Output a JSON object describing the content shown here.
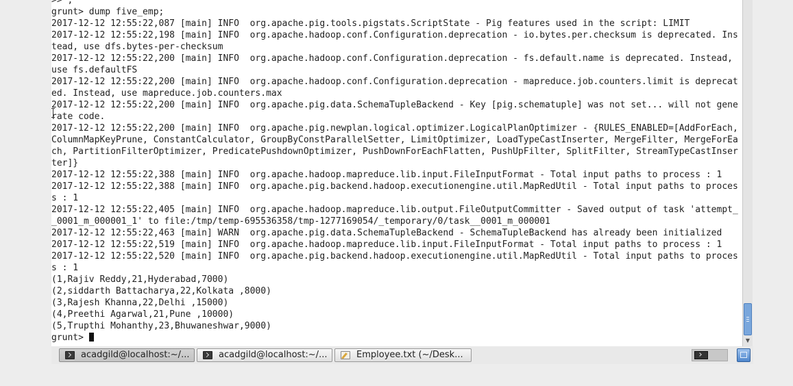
{
  "terminal": {
    "lines": [
      ">> ;",
      "grunt> dump five_emp;",
      "2017-12-12 12:55:22,087 [main] INFO  org.apache.pig.tools.pigstats.ScriptState - Pig features used in the script: LIMIT",
      "2017-12-12 12:55:22,198 [main] INFO  org.apache.hadoop.conf.Configuration.deprecation - io.bytes.per.checksum is deprecated. Instead, use dfs.bytes-per-checksum",
      "2017-12-12 12:55:22,200 [main] INFO  org.apache.hadoop.conf.Configuration.deprecation - fs.default.name is deprecated. Instead, use fs.defaultFS",
      "2017-12-12 12:55:22,200 [main] INFO  org.apache.hadoop.conf.Configuration.deprecation - mapreduce.job.counters.limit is deprecated. Instead, use mapreduce.job.counters.max",
      "2017-12-12 12:55:22,200 [main] INFO  org.apache.pig.data.SchemaTupleBackend - Key [pig.schematuple] was not set... will not generate code.",
      "2017-12-12 12:55:22,200 [main] INFO  org.apache.pig.newplan.logical.optimizer.LogicalPlanOptimizer - {RULES_ENABLED=[AddForEach, ColumnMapKeyPrune, ConstantCalculator, GroupByConstParallelSetter, LimitOptimizer, LoadTypeCastInserter, MergeFilter, MergeForEach, PartitionFilterOptimizer, PredicatePushdownOptimizer, PushDownForEachFlatten, PushUpFilter, SplitFilter, StreamTypeCastInserter]}",
      "2017-12-12 12:55:22,388 [main] INFO  org.apache.hadoop.mapreduce.lib.input.FileInputFormat - Total input paths to process : 1",
      "2017-12-12 12:55:22,388 [main] INFO  org.apache.pig.backend.hadoop.executionengine.util.MapRedUtil - Total input paths to process : 1",
      "2017-12-12 12:55:22,405 [main] INFO  org.apache.hadoop.mapreduce.lib.output.FileOutputCommitter - Saved output of task 'attempt__0001_m_000001_1' to file:/tmp/temp-695536358/tmp-1277169054/_temporary/0/task__0001_m_000001",
      "2017-12-12 12:55:22,463 [main] WARN  org.apache.pig.data.SchemaTupleBackend - SchemaTupleBackend has already been initialized",
      "2017-12-12 12:55:22,519 [main] INFO  org.apache.hadoop.mapreduce.lib.input.FileInputFormat - Total input paths to process : 1",
      "2017-12-12 12:55:22,520 [main] INFO  org.apache.pig.backend.hadoop.executionengine.util.MapRedUtil - Total input paths to process : 1",
      "(1,Rajiv Reddy,21,Hyderabad,7000)",
      "(2,siddarth Battacharya,22,Kolkata ,8000)",
      "(3,Rajesh Khanna,22,Delhi ,15000)",
      "(4,Preethi Agarwal,21,Pune ,10000)",
      "(5,Trupthi Mohanthy,23,Bhuwaneshwar,9000)"
    ],
    "prompt": "grunt> "
  },
  "taskbar": {
    "tasks": [
      {
        "label": "acadgild@localhost:~/...",
        "icon": "terminal-icon",
        "active": true
      },
      {
        "label": "acadgild@localhost:~/...",
        "icon": "terminal-icon",
        "active": false
      },
      {
        "label": "Employee.txt (~/Desk...",
        "icon": "text-editor-icon",
        "active": false
      }
    ]
  },
  "colors": {
    "terminal_bg": "#ffffff",
    "terminal_fg": "#222222",
    "scroll_thumb": "#7aa7dc",
    "taskbar_bg": "#e9e9e9"
  }
}
